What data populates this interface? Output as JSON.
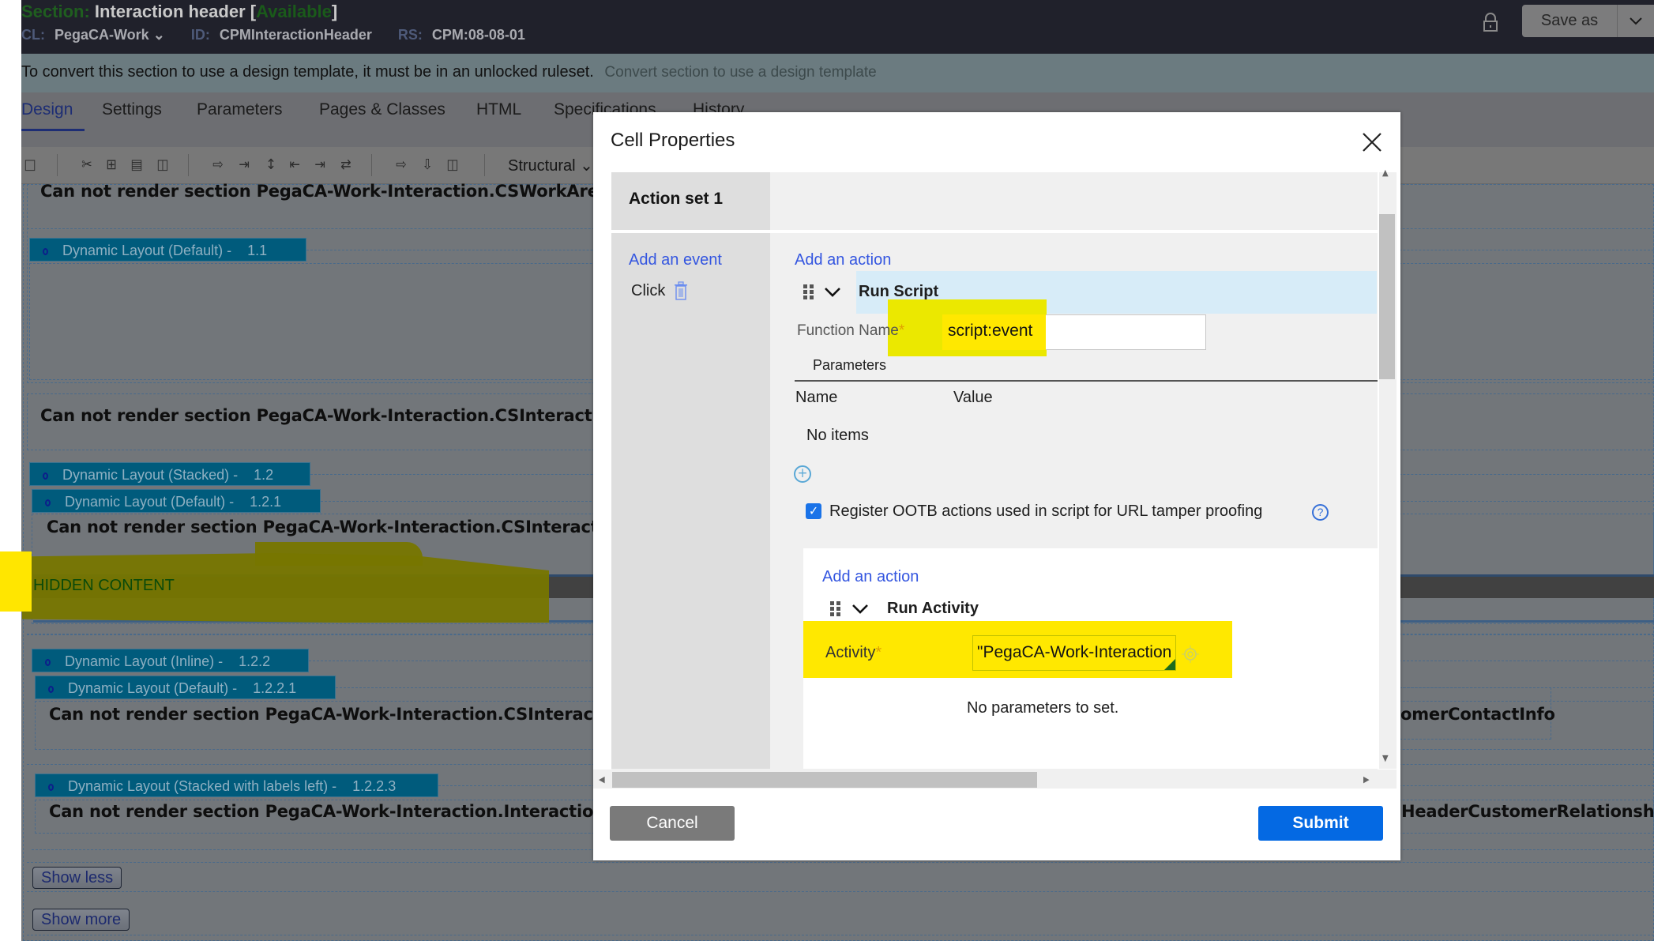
{
  "header": {
    "section_prefix": "Section:",
    "title": "Interaction header",
    "status": "Available",
    "meta": [
      {
        "key": "CL:",
        "value": "PegaCA-Work"
      },
      {
        "key": "ID:",
        "value": "CPMInteractionHeader"
      },
      {
        "key": "RS:",
        "value": "CPM:08-08-01"
      }
    ],
    "save_as_label": "Save as",
    "lock_icon": "lock-icon"
  },
  "infobar": {
    "message": "To convert this section to use a design template, it must be in an unlocked ruleset.",
    "link": "Convert section to use a design template"
  },
  "tabs": [
    {
      "label": "Design",
      "active": true
    },
    {
      "label": "Settings"
    },
    {
      "label": "Parameters"
    },
    {
      "label": "Pages & Classes"
    },
    {
      "label": "HTML"
    },
    {
      "label": "Specifications"
    },
    {
      "label": "History"
    }
  ],
  "toolbar": {
    "icons": [
      "layout-icon",
      "cut-icon",
      "add-file-icon",
      "paste-icon",
      "delete-icon",
      "insert-row-above-icon",
      "insert-row-below-icon",
      "move-vertical-icon",
      "insert-column-left-icon",
      "insert-column-right-icon",
      "merge-icon",
      "move-right-icon",
      "move-down-icon",
      "split-column-icon"
    ],
    "structural_label": "Structural"
  },
  "canvas": {
    "cannot_render": [
      "Can not render section PegaCA-Work-Interaction.CSWorkAreaResiz",
      "Can not render section PegaCA-Work-Interaction.CSInteractionHea",
      "Can not render section PegaCA-Work-Interaction.CSInteractionHea",
      "Can not render section PegaCA-Work-Interaction.CSInteractionHe",
      "Can not render section PegaCA-Work-Interaction.InteractionHead"
    ],
    "cannot_render_right": [
      "omerContactInfo",
      "HeaderCustomerRelationshipI"
    ],
    "layouts": [
      {
        "label": "Dynamic Layout (Default) -",
        "num": "1.1"
      },
      {
        "label": "Dynamic Layout (Stacked) -",
        "num": "1.2"
      },
      {
        "label": "Dynamic Layout (Default) -",
        "num": "1.2.1"
      },
      {
        "label": "Dynamic Layout (Inline) -",
        "num": "1.2.2"
      },
      {
        "label": "Dynamic Layout (Default) -",
        "num": "1.2.2.1"
      },
      {
        "label": "Dynamic Layout (Stacked with labels left) -",
        "num": "1.2.2.3"
      }
    ],
    "hidden_content": "HIDDEN CONTENT",
    "show_less": "Show less",
    "show_more": "Show more"
  },
  "dialog": {
    "title": "Cell Properties",
    "action_set": "Action set 1",
    "add_event": "Add an event",
    "event": "Click",
    "add_action": "Add an action",
    "action1": {
      "name": "Run Script",
      "function_label": "Function Name",
      "function_value": "script:event",
      "parameters_heading": "Parameters",
      "columns": [
        "Name",
        "Value"
      ],
      "empty": "No items"
    },
    "register_checkbox": {
      "label": "Register OOTB actions used in script for URL tamper proofing",
      "checked": true
    },
    "inner": {
      "add_action": "Add an action",
      "action_name": "Run Activity",
      "activity_label": "Activity",
      "activity_value": "\"PegaCA-Work-Interaction",
      "no_params": "No parameters to set."
    },
    "cancel": "Cancel",
    "submit": "Submit"
  },
  "colors": {
    "accent_blue": "#0469e3",
    "link_blue": "#3456e0",
    "highlight_yellow": "#ffe800",
    "layout_tag": "#005b7c"
  }
}
